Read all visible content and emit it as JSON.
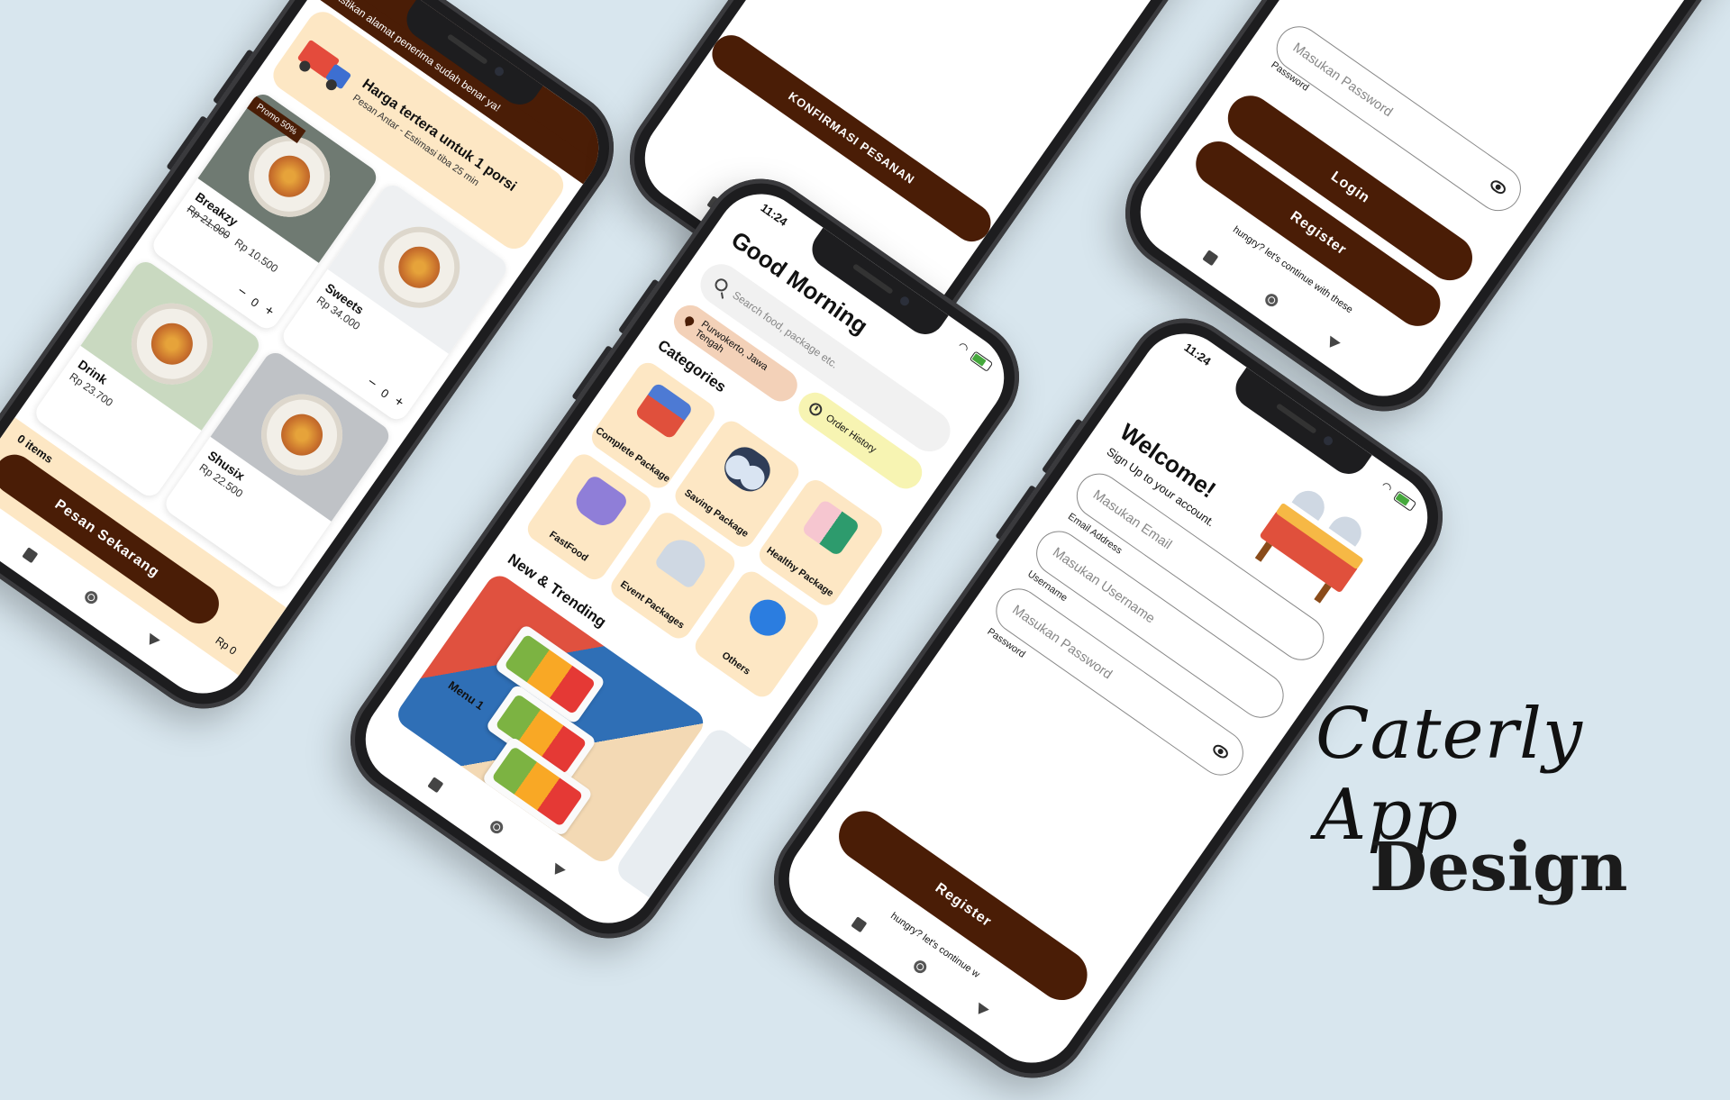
{
  "status": {
    "time": "11:24"
  },
  "product_screen": {
    "address_banner": "Pastikan alamat penerima sudah benar ya!",
    "info_title": "Harga tertera untuk 1 porsi",
    "info_subtitle": "Pesan Antar - Estimasi tiba 25 min",
    "products": [
      {
        "name": "Breakzy",
        "old_price": "Rp 21.000",
        "price": "Rp 10.500",
        "promo": "Promo 50%",
        "qty": "0"
      },
      {
        "name": "Sweets",
        "price": "Rp 34.000",
        "qty": "0"
      },
      {
        "name": "Drink",
        "price": "Rp 23.700"
      },
      {
        "name": "Shusix",
        "price": "Rp 22.500"
      }
    ],
    "cart_items": "0 items",
    "cart_total": "Rp 0",
    "order_button": "Pesan Sekarang"
  },
  "confirm_screen": {
    "confirm_button": "KONFIRMASI PESANAN"
  },
  "login_screen": {
    "password_placeholder": "Masukan Password",
    "password_label": "Password",
    "login_button": "Login",
    "register_button": "Register",
    "hint": "hungry? let's continue with these"
  },
  "home_screen": {
    "greeting": "Good Morning",
    "search_placeholder": "Search food, package etc.",
    "location": "Purwokerto, Jawa Tengah",
    "order_history": "Order History",
    "categories_title": "Categories",
    "categories": [
      {
        "label": "Complete Package",
        "icon": "package-icon"
      },
      {
        "label": "Saving Package",
        "icon": "saving-icon"
      },
      {
        "label": "Healthy Package",
        "icon": "healthy-icon"
      },
      {
        "label": "FastFood",
        "icon": "fastfood-icon"
      },
      {
        "label": "Event Packages",
        "icon": "event-icon"
      },
      {
        "label": "Others",
        "icon": "others-icon"
      }
    ],
    "trending_title": "New & Trending",
    "trend_label": "Menu 1"
  },
  "register_screen": {
    "welcome": "Welcome!",
    "subtitle": "Sign Up to your account.",
    "email_label": "Masukan Email",
    "email_field_label": "Email Address",
    "username_placeholder": "Masukan Username",
    "username_label": "Username",
    "password_placeholder": "Masukan Password",
    "password_label": "Password",
    "register_button": "Register",
    "hint": "hungry? let's continue w"
  },
  "branding": {
    "script": "Caterly App",
    "design": "Design"
  }
}
